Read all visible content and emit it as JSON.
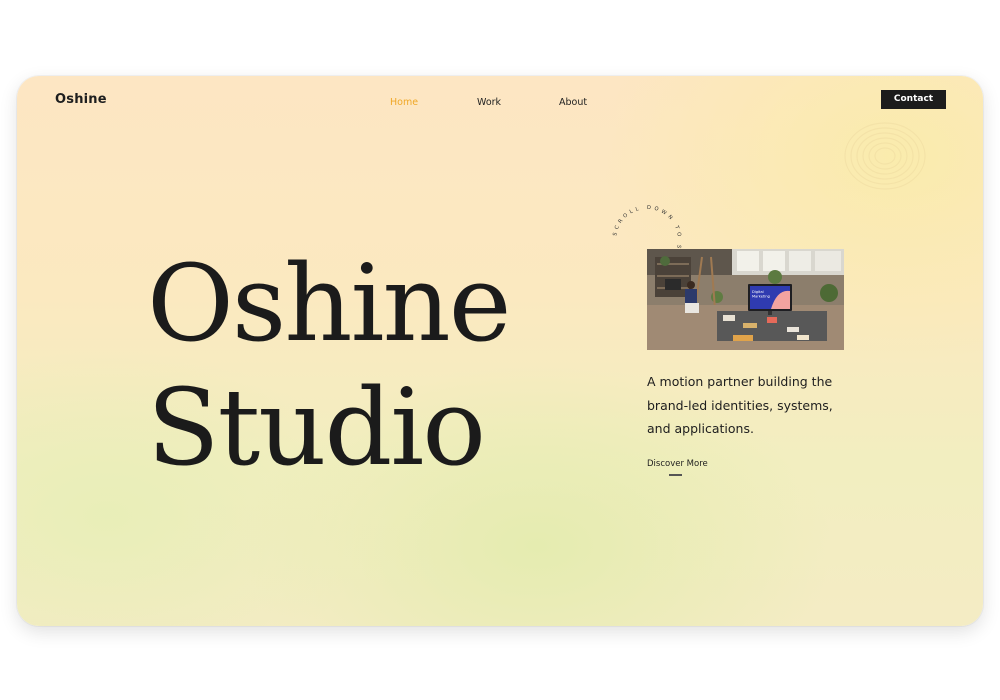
{
  "brand": {
    "logo_text": "Oshine"
  },
  "nav": {
    "items": [
      {
        "label": "Home",
        "active": true
      },
      {
        "label": "Work",
        "active": false
      },
      {
        "label": "About",
        "active": false
      }
    ],
    "contact_label": "Contact"
  },
  "hero": {
    "title_line1": "Oshine",
    "title_line2": "Studio",
    "scroll_text": "SCROLL DOWN TO SEE",
    "image_screen_text_line1": "Digital",
    "image_screen_text_line2": "Marketing",
    "tagline": "A motion partner building the brand-led identities, systems, and applications.",
    "cta_label": "Discover More"
  },
  "colors": {
    "accent": "#f0a727",
    "text": "#1e1e1e",
    "button_bg": "#1c1c1c",
    "button_text": "#ffffff"
  }
}
